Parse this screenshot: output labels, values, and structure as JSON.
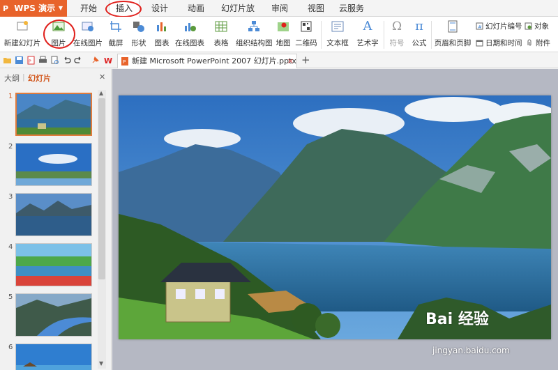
{
  "app": {
    "logo": "P",
    "name": "WPS 演示",
    "menu_caret": "▼"
  },
  "tabs": [
    {
      "label": "开始"
    },
    {
      "label": "插入"
    },
    {
      "label": "设计"
    },
    {
      "label": "动画"
    },
    {
      "label": "幻灯片放映"
    },
    {
      "label": "审阅"
    },
    {
      "label": "视图"
    },
    {
      "label": "云服务"
    }
  ],
  "active_tab": "插入",
  "ribbon": {
    "new_slide": "新建幻灯片",
    "picture": "图片",
    "online_picture": "在线图片",
    "screenshot": "截屏",
    "shapes": "形状",
    "chart": "图表",
    "online_chart": "在线图表",
    "table": "表格",
    "smartart": "组织结构图",
    "map": "地图",
    "qrcode": "二维码",
    "textbox": "文本框",
    "wordart": "艺术字",
    "symbol": "符号",
    "formula": "公式",
    "header_footer": "页眉和页脚",
    "slide_number": "幻灯片编号",
    "object": "对象",
    "date_time": "日期和时间",
    "attachment": "附件",
    "symbol_glyph": "Ω",
    "formula_glyph": "π",
    "wordart_glyph": "A"
  },
  "doc": {
    "tab_title": "新建 Microsoft PowerPoint 2007 幻灯片.pptx",
    "close_glyph": "×",
    "add_glyph": "+"
  },
  "panel": {
    "outline_label": "大纲",
    "divider": "|",
    "slides_label": "幻灯片",
    "close_glyph": "✕",
    "slides": [
      {
        "num": "1"
      },
      {
        "num": "2"
      },
      {
        "num": "3"
      },
      {
        "num": "4"
      },
      {
        "num": "5"
      },
      {
        "num": "6"
      }
    ]
  },
  "watermark": {
    "brand": "Bai 经验",
    "url": "jingyan.baidu.com"
  },
  "colors": {
    "accent": "#e8632b",
    "highlight_circle": "#e0201c",
    "active_slide_border": "#e07b3c"
  }
}
